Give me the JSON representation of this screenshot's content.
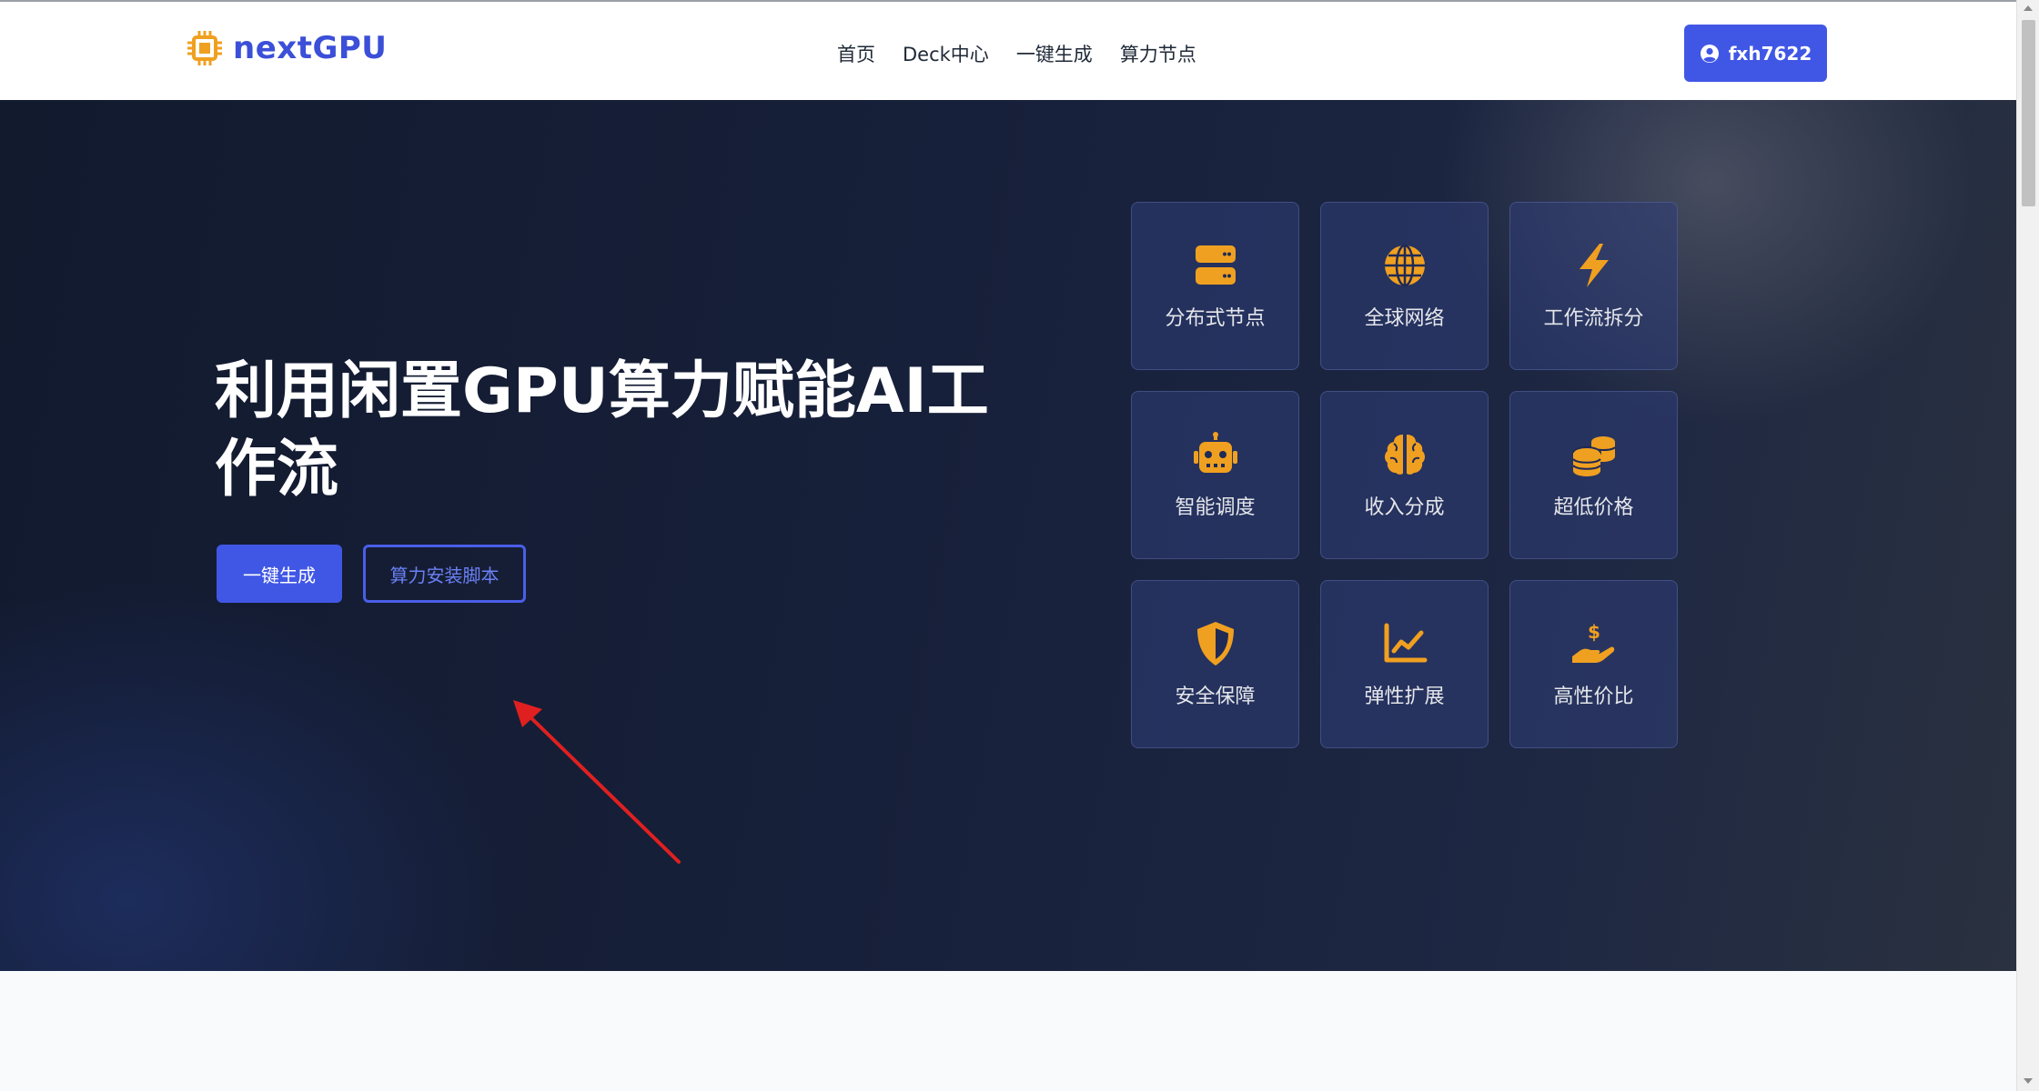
{
  "header": {
    "brand": "nextGPU",
    "nav": [
      "首页",
      "Deck中心",
      "一键生成",
      "算力节点"
    ],
    "user": "fxh7622"
  },
  "hero": {
    "title": "利用闲置GPU算力赋能AI工作流",
    "primary_button": "一键生成",
    "secondary_button": "算力安装脚本"
  },
  "features": [
    {
      "label": "分布式节点",
      "icon": "server-icon"
    },
    {
      "label": "全球网络",
      "icon": "globe-icon"
    },
    {
      "label": "工作流拆分",
      "icon": "bolt-icon"
    },
    {
      "label": "智能调度",
      "icon": "robot-icon"
    },
    {
      "label": "收入分成",
      "icon": "brain-icon"
    },
    {
      "label": "超低价格",
      "icon": "coins-icon"
    },
    {
      "label": "安全保障",
      "icon": "shield-icon"
    },
    {
      "label": "弹性扩展",
      "icon": "chart-line-icon"
    },
    {
      "label": "高性价比",
      "icon": "hand-dollar-icon"
    }
  ],
  "colors": {
    "accent": "#4057e6",
    "icon": "#f0a020",
    "hero_bg": "#161e35",
    "annotation_arrow": "#e02020"
  }
}
